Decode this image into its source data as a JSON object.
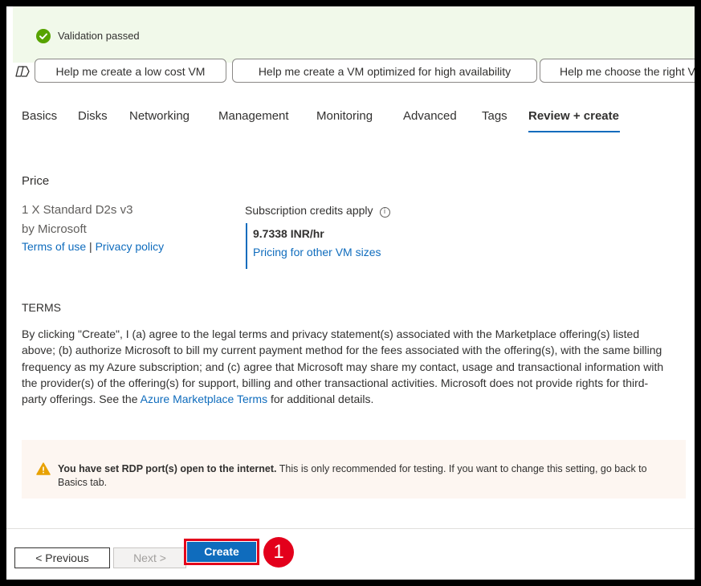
{
  "validation": {
    "text": "Validation passed"
  },
  "suggestions": [
    "Help me create a low cost VM",
    "Help me create a VM optimized for high availability",
    "Help me choose the right VM"
  ],
  "tabs": [
    "Basics",
    "Disks",
    "Networking",
    "Management",
    "Monitoring",
    "Advanced",
    "Tags",
    "Review + create"
  ],
  "active_tab": "Review + create",
  "price": {
    "heading": "Price",
    "product": "1 X Standard D2s v3",
    "publisher": "by Microsoft",
    "terms_link": "Terms of use",
    "separator": "|",
    "privacy_link": "Privacy policy",
    "credits_label": "Subscription credits apply",
    "rate": "9.7338 INR/hr",
    "pricing_link": "Pricing for other VM sizes"
  },
  "terms": {
    "heading": "TERMS",
    "body_before": "By clicking \"Create\", I (a) agree to the legal terms and privacy statement(s) associated with the Marketplace offering(s) listed above; (b) authorize Microsoft to bill my current payment method for the fees associated with the offering(s), with the same billing frequency as my Azure subscription; and (c) agree that Microsoft may share my contact, usage and transactional information with the provider(s) of the offering(s) for support, billing and other transactional activities. Microsoft does not provide rights for third-party offerings. See the ",
    "marketplace_link": "Azure Marketplace Terms",
    "body_after": " for additional details."
  },
  "warning": {
    "bold": "You have set RDP port(s) open to the internet.",
    "text": "  This is only recommended for testing.  If you want to change this setting, go back to Basics tab."
  },
  "footer": {
    "previous": "< Previous",
    "next": "Next >",
    "create": "Create",
    "marker": "1"
  },
  "colors": {
    "accent": "#0f6cbd",
    "success": "#57a300",
    "warning": "#e8a100",
    "highlight": "#e3001b"
  }
}
